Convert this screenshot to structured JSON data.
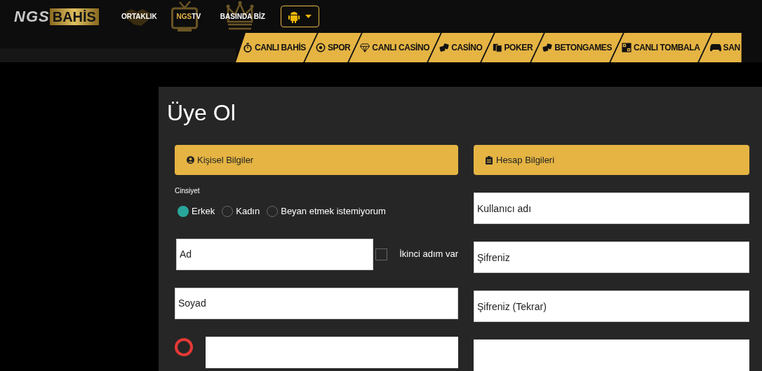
{
  "header": {
    "logo": {
      "part_1": "NGS",
      "part_2": "BAHİS"
    },
    "links": [
      {
        "kind": "plain",
        "label": "ORTAKLIK"
      },
      {
        "kind": "split",
        "label_1": "NGS",
        "label_2": "TV"
      },
      {
        "kind": "plain",
        "label": "BASINDA BİZ"
      }
    ]
  },
  "menu": [
    {
      "label": "CANLI BAHİS"
    },
    {
      "label": "SPOR"
    },
    {
      "label": "CANLI CASİNO"
    },
    {
      "label": "CASİNO"
    },
    {
      "label": "POKER"
    },
    {
      "label": "BETONGAMES"
    },
    {
      "label": "CANLI TOMBALA"
    },
    {
      "label": "SAN"
    }
  ],
  "form": {
    "title": "Üye Ol",
    "personal": {
      "heading": "Kişisel Bilgiler",
      "gender_label": "Cinsiyet",
      "genders": [
        {
          "label": "Erkek",
          "selected": true
        },
        {
          "label": "Kadın",
          "selected": false
        },
        {
          "label": "Beyan etmek istemiyorum",
          "selected": false
        }
      ],
      "first_name": {
        "placeholder": "Ad"
      },
      "second_name": {
        "label": "İkinci adım var",
        "checked": false
      },
      "last_name": {
        "placeholder": "Soyad"
      }
    },
    "account": {
      "heading": "Hesap Bilgileri",
      "fields": [
        {
          "placeholder": "Kullanıcı adı"
        },
        {
          "placeholder": "Şifreniz"
        },
        {
          "placeholder": "Şifreniz (Tekrar)"
        }
      ]
    }
  }
}
